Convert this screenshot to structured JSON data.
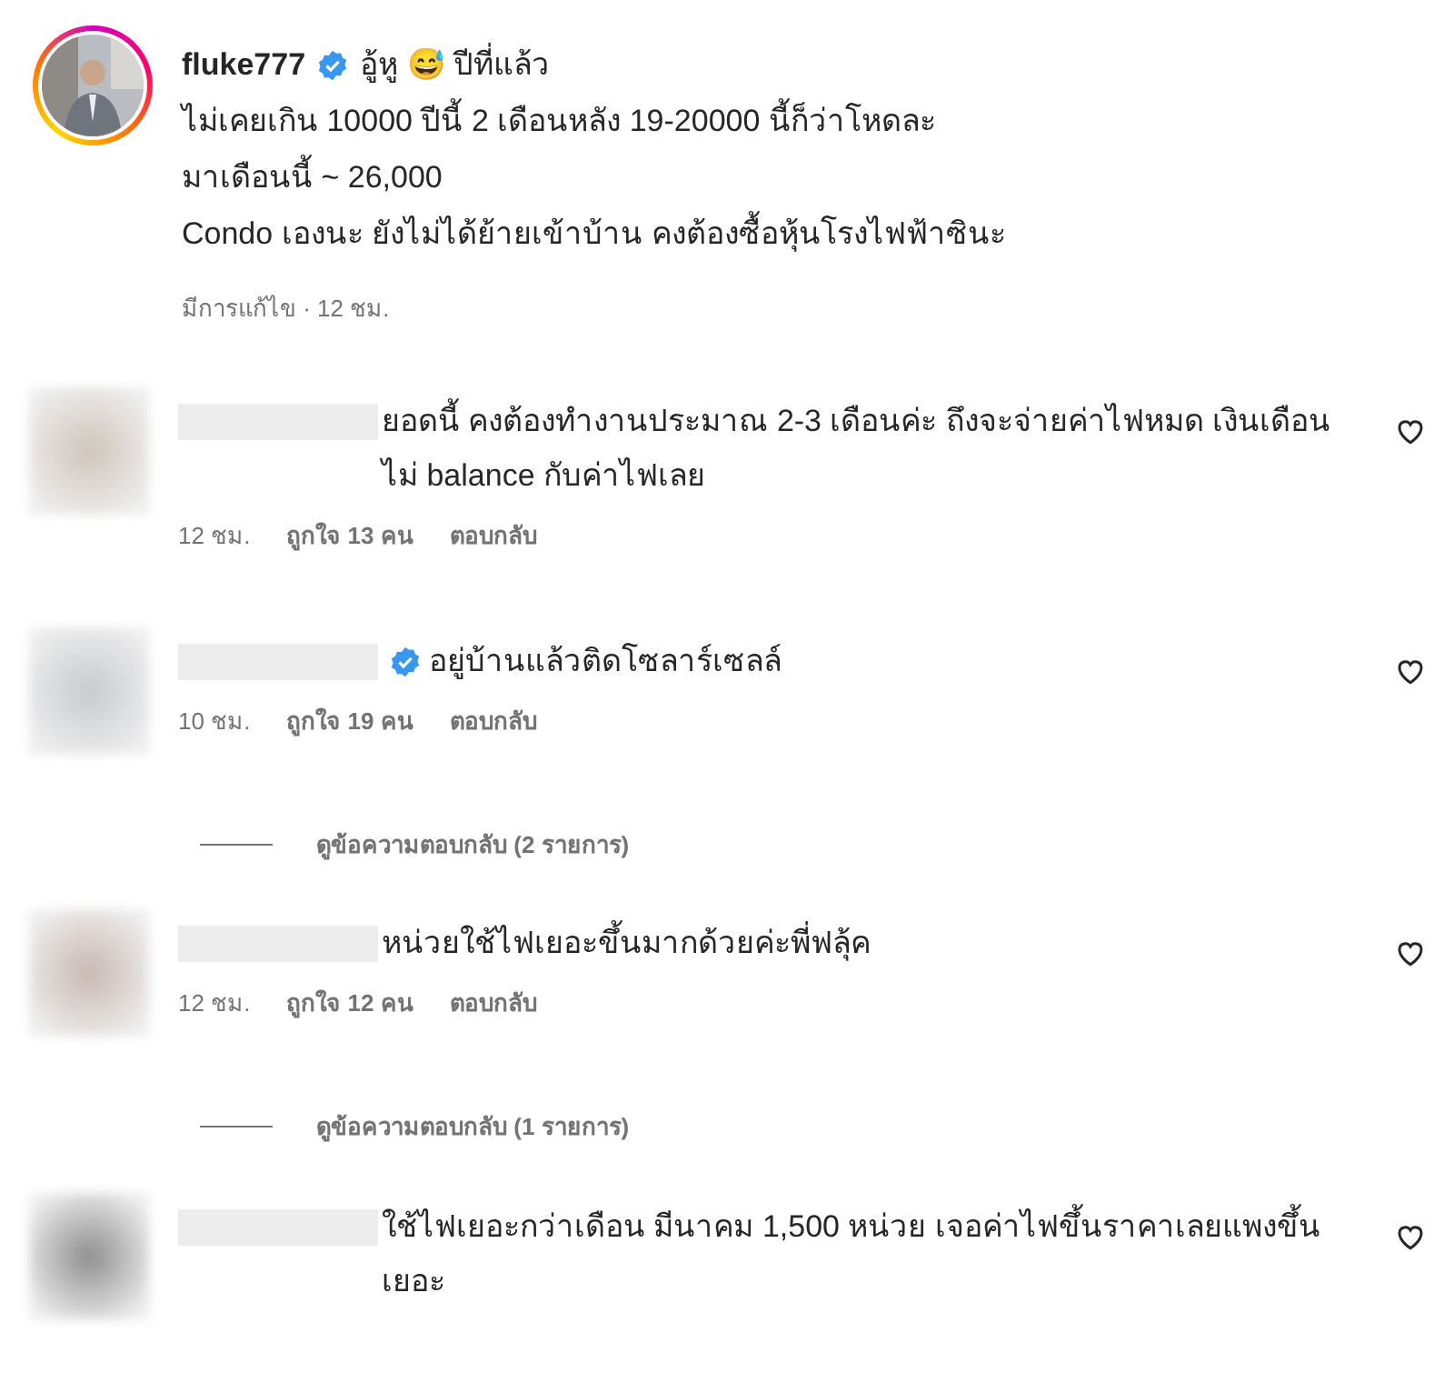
{
  "post": {
    "username": "fluke777",
    "verified": true,
    "headline": "อู้หู 😅 ปีที่แล้ว",
    "caption_lines": [
      "ไม่เคยเกิน 10000 ปีนี้ 2 เดือนหลัง 19-20000 นี้ก็ว่าโหดละ",
      "มาเดือนนี้ ~ 26,000",
      "Condo เองนะ ยังไม่ได้ย้ายเข้าบ้าน คงต้องซื้อหุ้นโรงไฟฟ้าซินะ"
    ],
    "meta": "มีการแก้ไข · 12 ชม."
  },
  "comments": [
    {
      "verified": false,
      "text": "ยอดนี้ คงต้องทำงานประมาณ 2-3 เดือนค่ะ ถึงจะจ่ายค่าไฟหมด เงินเดือนไม่ balance กับค่าไฟเลย",
      "time": "12 ชม.",
      "likes": "ถูกใจ 13 คน",
      "reply": "ตอบกลับ"
    },
    {
      "verified": true,
      "text": "อยู่บ้านแล้วติดโซลาร์เซลล์",
      "time": "10 ชม.",
      "likes": "ถูกใจ 19 คน",
      "reply": "ตอบกลับ",
      "view_replies": "ดูข้อความตอบกลับ (2 รายการ)"
    },
    {
      "verified": false,
      "text": "หน่วยใช้ไฟเยอะขึ้นมากด้วยค่ะพี่ฟลุ้ค",
      "time": "12 ชม.",
      "likes": "ถูกใจ 12 คน",
      "reply": "ตอบกลับ",
      "view_replies": "ดูข้อความตอบกลับ (1 รายการ)"
    },
    {
      "verified": false,
      "text": "ใช้ไฟเยอะกว่าเดือน มีนาคม 1,500 หน่วย เจอค่าไฟขึ้นราคาเลยแพงขึ้นเยอะ"
    }
  ]
}
